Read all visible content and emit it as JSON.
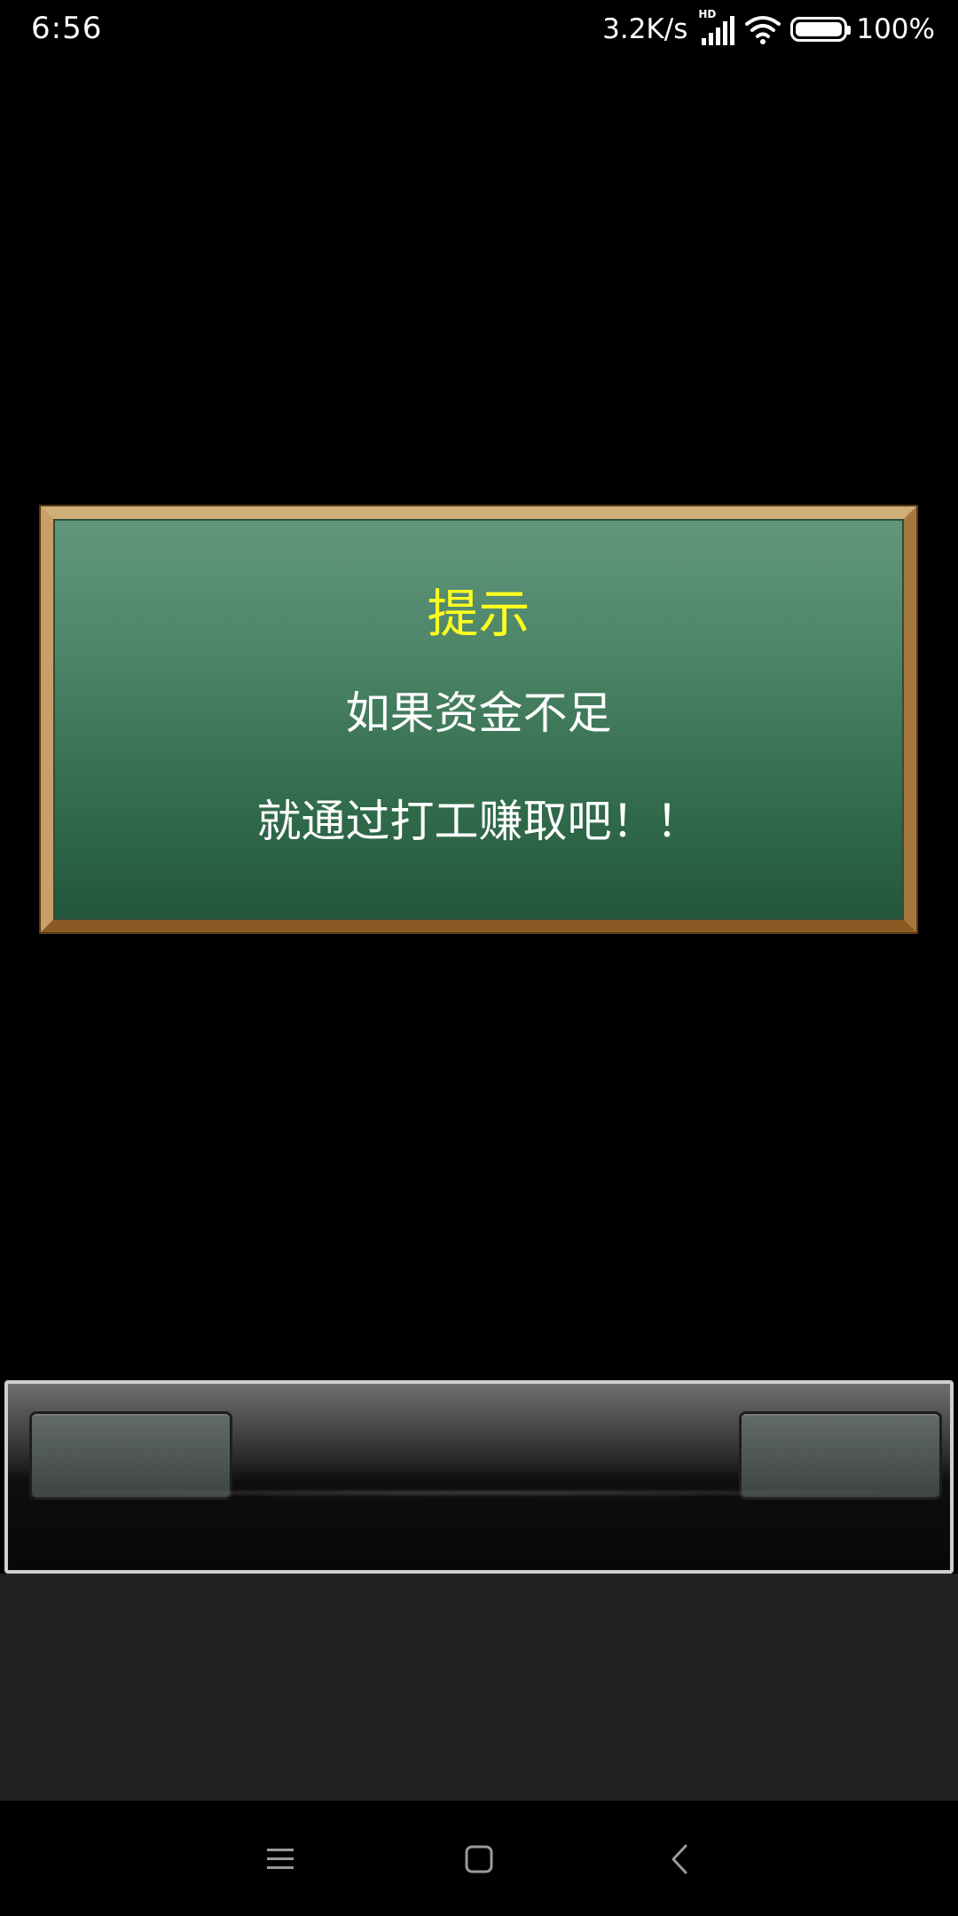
{
  "status_bar": {
    "time": "6:56",
    "net_speed": "3.2K/s",
    "signal_tag": "HD",
    "battery": "100%"
  },
  "dialog": {
    "title": "提示",
    "line1": "如果资金不足",
    "line2": "就通过打工赚取吧！！"
  },
  "colors": {
    "title": "#ffff20",
    "dialog_bg_top": "#62977c",
    "dialog_bg_bottom": "#23563a",
    "frame": "#b28447",
    "lower_area": "#212121"
  },
  "icons": {
    "menu": "menu-icon",
    "home": "home-icon",
    "back": "back-icon"
  }
}
